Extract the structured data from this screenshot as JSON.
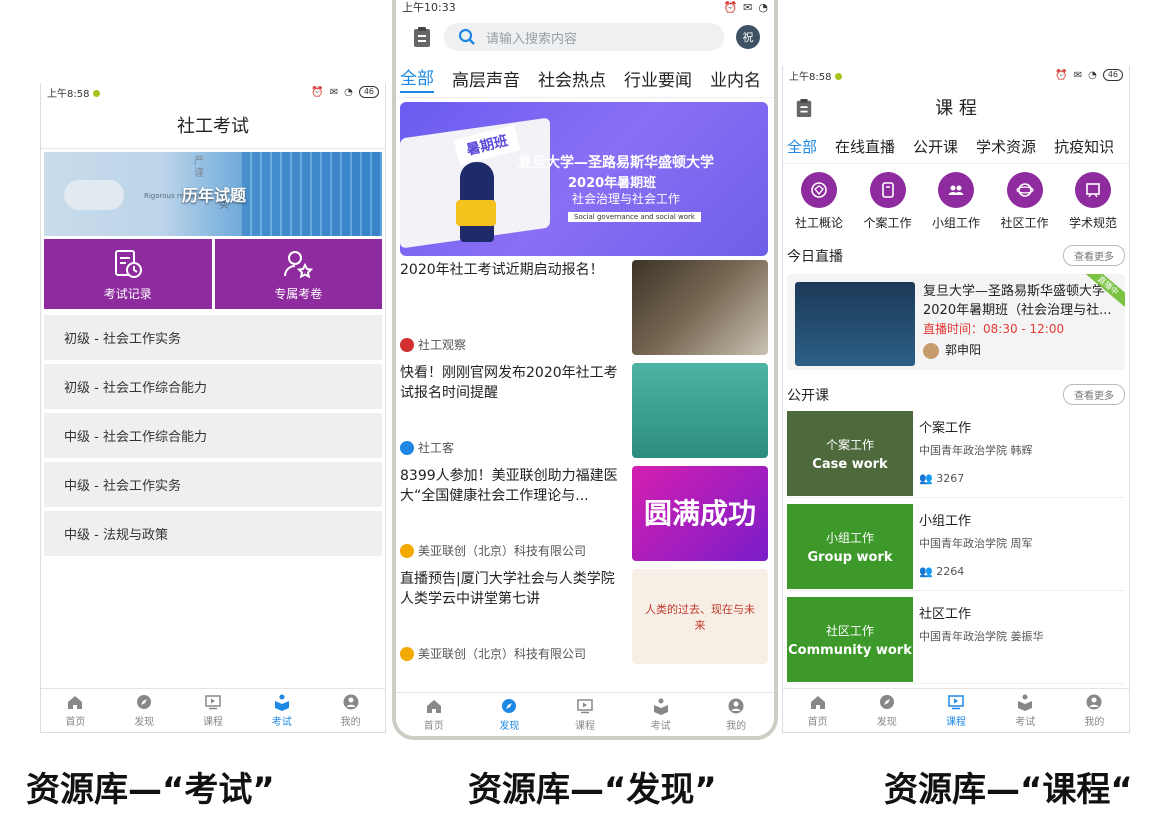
{
  "captions": [
    "资源库—“考试”",
    "资源库—“发现”",
    "资源库—“课程“"
  ],
  "colors": {
    "purple": "#8e2b9e",
    "blue": "#1e88e5",
    "green_dark": "#4e6a3c",
    "green": "#3d9a2a"
  },
  "exam_screen": {
    "status_time": "上午8:58",
    "battery": "46",
    "title": "社工考试",
    "banner": {
      "text": "历年试题",
      "vertical_text": "严谨",
      "vertical_text2": "实",
      "english": "Rigorous  realistic"
    },
    "tiles": [
      {
        "label": "考试记录",
        "icon": "exam-record-icon"
      },
      {
        "label": "专属考卷",
        "icon": "exclusive-paper-icon"
      }
    ],
    "list": [
      "初级 - 社会工作实务",
      "初级 - 社会工作综合能力",
      "中级 - 社会工作综合能力",
      "中级 - 社会工作实务",
      "中级 - 法规与政策"
    ],
    "tabbar": [
      {
        "label": "首页"
      },
      {
        "label": "发现"
      },
      {
        "label": "课程"
      },
      {
        "label": "考试",
        "active": true
      },
      {
        "label": "我的"
      }
    ]
  },
  "discover_screen": {
    "status_time": "上午10:33",
    "search_placeholder": "请输入搜索内容",
    "avatar_text": "祝",
    "tabs": [
      "全部",
      "高层声音",
      "社会热点",
      "行业要闻",
      "业内名"
    ],
    "banner": {
      "tag": "暑期班",
      "line1": "复旦大学—圣路易斯华盛顿大学",
      "line2": "2020年暑期班",
      "line3": "社会治理与社会工作",
      "line4": "Social governance and social work"
    },
    "news": [
      {
        "title": "2020年社工考试近期启动报名！",
        "source": "社工观察"
      },
      {
        "title": "快看！刚刚官网发布2020年社工考试报名时间提醒",
        "source": "社工客"
      },
      {
        "title": "8399人参加！美亚联创助力福建医大“全国健康社会工作理论与...",
        "source": "美亚联创（北京）科技有限公司",
        "image_text": "圆满成功"
      },
      {
        "title": "直播预告|厦门大学社会与人类学院人类学云中讲堂第七讲",
        "source": "美亚联创（北京）科技有限公司",
        "image_text": "人类的过去、现在与未来"
      }
    ],
    "tabbar": [
      {
        "label": "首页"
      },
      {
        "label": "发现",
        "active": true
      },
      {
        "label": "课程"
      },
      {
        "label": "考试"
      },
      {
        "label": "我的"
      }
    ]
  },
  "course_screen": {
    "status_time": "上午8:58",
    "battery": "46",
    "title": "课 程",
    "tabs": [
      "全部",
      "在线直播",
      "公开课",
      "学术资源",
      "抗疫知识"
    ],
    "categories": [
      "社工概论",
      "个案工作",
      "小组工作",
      "社区工作",
      "学术规范"
    ],
    "today_live": {
      "heading": "今日直播",
      "more": "查看更多",
      "title": "复旦大学—圣路易斯华盛顿大学2020年暑期班（社会治理与社...",
      "time": "直播时间：08:30 - 12:00",
      "teacher": "郭申阳",
      "ribbon": "直播中"
    },
    "open_courses": {
      "heading": "公开课",
      "more": "查看更多"
    },
    "courses": [
      {
        "zh": "个案工作",
        "en": "Case work",
        "title": "个案工作",
        "org": "中国青年政治学院  韩辉",
        "count": "3267"
      },
      {
        "zh": "小组工作",
        "en": "Group work",
        "title": "小组工作",
        "org": "中国青年政治学院  周军",
        "count": "2264"
      },
      {
        "zh": "社区工作",
        "en": "Community work",
        "title": "社区工作",
        "org": "中国青年政治学院  姜振华",
        "count": ""
      }
    ],
    "tabbar": [
      {
        "label": "首页"
      },
      {
        "label": "发现"
      },
      {
        "label": "课程",
        "active": true
      },
      {
        "label": "考试"
      },
      {
        "label": "我的"
      }
    ]
  }
}
